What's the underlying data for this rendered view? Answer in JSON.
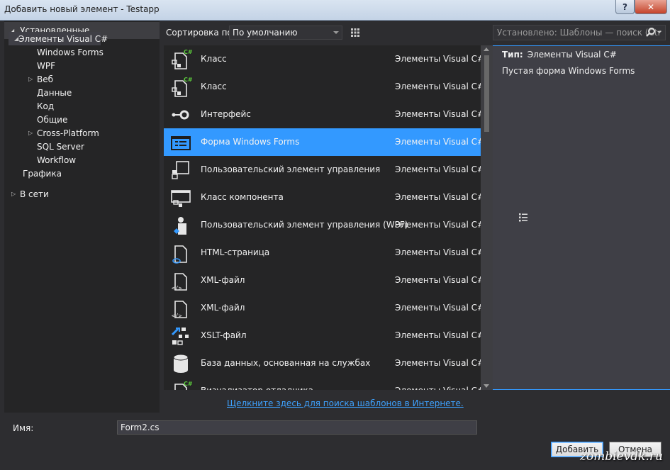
{
  "window": {
    "title": "Добавить новый элемент - Testapp",
    "help_label": "?",
    "close_label": "✕"
  },
  "tree": {
    "header": "Установленные",
    "items": [
      {
        "label": "Элементы Visual C#",
        "level": 0,
        "expander": "expanded",
        "selected": true
      },
      {
        "label": "Windows Forms",
        "level": 1,
        "expander": "none"
      },
      {
        "label": "WPF",
        "level": 1,
        "expander": "none"
      },
      {
        "label": "Веб",
        "level": 1,
        "expander": "collapsed"
      },
      {
        "label": "Данные",
        "level": 1,
        "expander": "none"
      },
      {
        "label": "Код",
        "level": 1,
        "expander": "none"
      },
      {
        "label": "Общие",
        "level": 1,
        "expander": "none"
      },
      {
        "label": "Cross-Platform",
        "level": 1,
        "expander": "collapsed"
      },
      {
        "label": "SQL Server",
        "level": 1,
        "expander": "none"
      },
      {
        "label": "Workflow",
        "level": 1,
        "expander": "none"
      },
      {
        "label": "Графика",
        "level": 0,
        "expander": "none"
      },
      {
        "label": "В сети",
        "level": -1,
        "expander": "collapsed"
      }
    ]
  },
  "toolbar": {
    "sort_label": "Сортировка по:",
    "sort_value": "По умолчанию",
    "search_placeholder": "Установлено: Шаблоны — поиск (Ctr"
  },
  "templates": [
    {
      "name": "Класс",
      "category": "Элементы Visual C#",
      "icon": "class-icon"
    },
    {
      "name": "Класс",
      "category": "Элементы Visual C#",
      "icon": "class-icon"
    },
    {
      "name": "Интерфейс",
      "category": "Элементы Visual C#",
      "icon": "interface-icon"
    },
    {
      "name": "Форма Windows Forms",
      "category": "Элементы Visual C#",
      "icon": "windows-form-icon",
      "selected": true
    },
    {
      "name": "Пользовательский элемент управления",
      "category": "Элементы Visual C#",
      "icon": "user-control-icon"
    },
    {
      "name": "Класс компонента",
      "category": "Элементы Visual C#",
      "icon": "component-class-icon"
    },
    {
      "name": "Пользовательский элемент управления (WPF)",
      "category": "Элементы Visual C#",
      "icon": "wpf-user-control-icon"
    },
    {
      "name": "HTML-страница",
      "category": "Элементы Visual C#",
      "icon": "html-page-icon"
    },
    {
      "name": "XML-файл",
      "category": "Элементы Visual C#",
      "icon": "xml-file-icon"
    },
    {
      "name": "XML-файл",
      "category": "Элементы Visual C#",
      "icon": "xml-file-icon"
    },
    {
      "name": "XSLT-файл",
      "category": "Элементы Visual C#",
      "icon": "xslt-file-icon"
    },
    {
      "name": "База данных, основанная на службах",
      "category": "Элементы Visual C#",
      "icon": "database-icon"
    },
    {
      "name": "Визуализатор отладчика",
      "category": "Элементы Visual C#",
      "icon": "debugger-visualizer-icon"
    }
  ],
  "details": {
    "type_label": "Тип:",
    "type_value": "Элементы Visual C#",
    "description": "Пустая форма Windows Forms"
  },
  "online_link": "Щелкните здесь для поиска шаблонов в Интернете.",
  "name_field": {
    "label": "Имя:",
    "value": "Form2.cs"
  },
  "buttons": {
    "add": "Добавить",
    "cancel": "Отмена"
  },
  "watermark": "zombievdk.ru",
  "colors": {
    "accent": "#3399ff",
    "background": "#2d2d30",
    "panel": "#252526",
    "csharp_green": "#5ccb3c"
  }
}
